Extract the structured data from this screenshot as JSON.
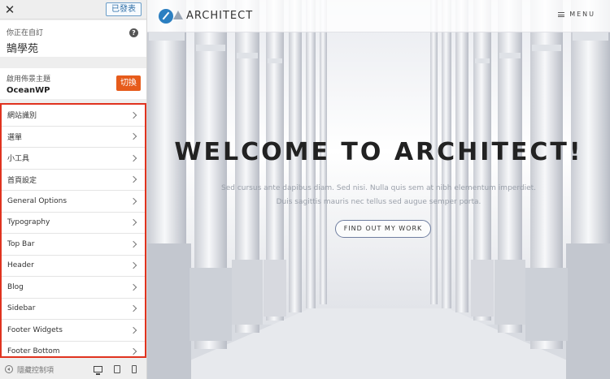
{
  "customizer": {
    "publish_label": "已發表",
    "customizing_label": "你正在自訂",
    "site_name": "鵠學苑",
    "active_theme_label": "啟用佈景主題",
    "theme_name": "OceanWP",
    "change_label": "切換",
    "sections": [
      {
        "label": "網站識別"
      },
      {
        "label": "選單"
      },
      {
        "label": "小工具"
      },
      {
        "label": "首頁設定"
      },
      {
        "label": "General Options"
      },
      {
        "label": "Typography"
      },
      {
        "label": "Top Bar"
      },
      {
        "label": "Header"
      },
      {
        "label": "Blog"
      },
      {
        "label": "Sidebar"
      },
      {
        "label": "Footer Widgets"
      },
      {
        "label": "Footer Bottom"
      }
    ],
    "collapse_label": "隱藏控制項",
    "accent_color": "#e65b1b",
    "highlight_border_color": "#e0331f"
  },
  "site": {
    "title": "ARCHITECT",
    "menu_label": "MENU",
    "hero_title": "WELCOME TO ARCHITECT!",
    "hero_line1": "Sed cursus ante dapibus diam. Sed nisi. Nulla quis sem at nibh elementum imperdiet.",
    "hero_line2": "Duis sagittis mauris nec tellus sed augue semper porta.",
    "cta_label": "FIND OUT MY WORK"
  }
}
